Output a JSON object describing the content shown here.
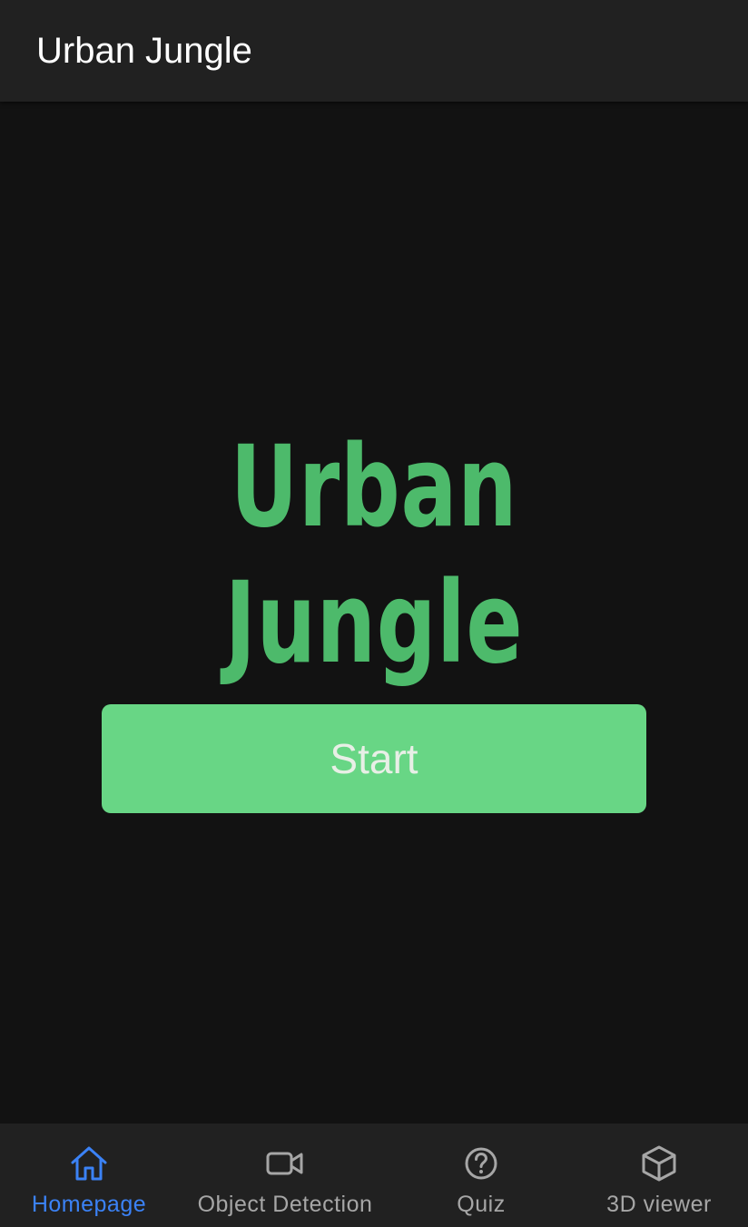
{
  "app_bar": {
    "title": "Urban Jungle"
  },
  "hero": {
    "title": "Urban Jungle"
  },
  "start_button": {
    "label": "Start"
  },
  "bottom_nav": {
    "items": [
      {
        "label": "Homepage",
        "icon": "home-icon",
        "active": true
      },
      {
        "label": "Object Detection",
        "icon": "video-camera-icon",
        "active": false
      },
      {
        "label": "Quiz",
        "icon": "question-circle-icon",
        "active": false
      },
      {
        "label": "3D viewer",
        "icon": "cube-icon",
        "active": false
      }
    ]
  },
  "colors": {
    "background": "#121212",
    "bar": "#212121",
    "accent_green": "#4dba6b",
    "button_green": "#68d685",
    "active_blue": "#3b82f6",
    "inactive_gray": "#a6a6a6"
  }
}
